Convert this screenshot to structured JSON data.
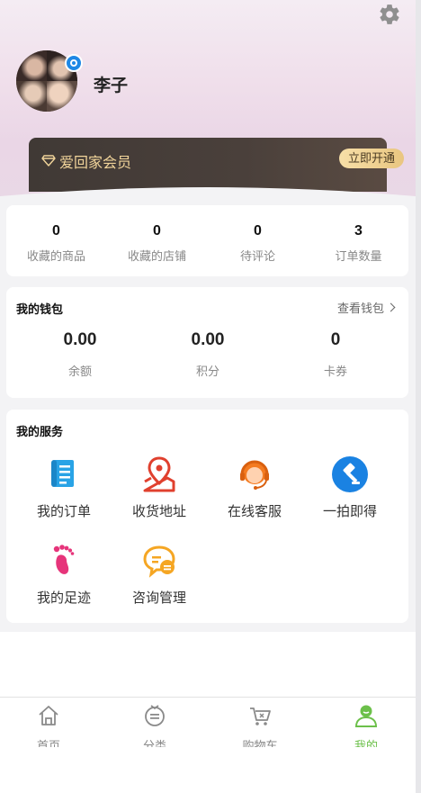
{
  "profile": {
    "username": "李子"
  },
  "member": {
    "title": "爱回家会员",
    "button_label": "立即开通"
  },
  "stats": [
    {
      "value": "0",
      "label": "收藏的商品"
    },
    {
      "value": "0",
      "label": "收藏的店铺"
    },
    {
      "value": "0",
      "label": "待评论"
    },
    {
      "value": "3",
      "label": "订单数量"
    }
  ],
  "wallet": {
    "title": "我的钱包",
    "link_label": "查看钱包",
    "items": [
      {
        "value": "0.00",
        "label": "余额"
      },
      {
        "value": "0.00",
        "label": "积分"
      },
      {
        "value": "0",
        "label": "卡券"
      }
    ]
  },
  "services": {
    "title": "我的服务",
    "items": [
      {
        "label": "我的订单",
        "icon": "order-list-icon"
      },
      {
        "label": "收货地址",
        "icon": "map-pin-icon"
      },
      {
        "label": "在线客服",
        "icon": "headset-icon"
      },
      {
        "label": "一拍即得",
        "icon": "auction-hammer-icon"
      },
      {
        "label": "我的足迹",
        "icon": "footprint-icon"
      },
      {
        "label": "咨询管理",
        "icon": "chat-bubble-icon"
      }
    ]
  },
  "tabbar": [
    {
      "label": "首页",
      "icon": "home-icon"
    },
    {
      "label": "分类",
      "icon": "category-icon"
    },
    {
      "label": "购物车",
      "icon": "cart-icon"
    },
    {
      "label": "我的",
      "icon": "user-icon",
      "active": true
    }
  ],
  "colors": {
    "accent": "#6cc04a",
    "member_gold": "#f1d49a",
    "member_card": "#433b37"
  }
}
